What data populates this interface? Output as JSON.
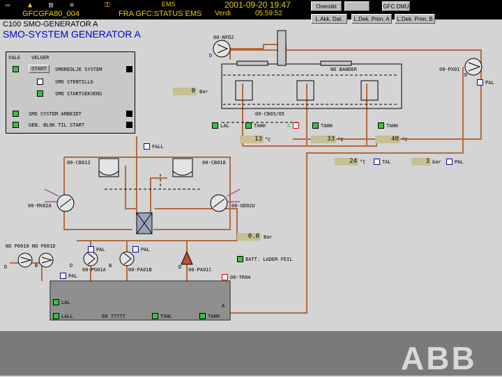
{
  "topbar": {
    "app": "EMS",
    "datetime": "2001-09-20 19:47",
    "station": "GFCGFA80_004",
    "source": "FRA GFC:STATUS EMS",
    "value_label": "Verdi",
    "time": "05:59:52",
    "btn_oversikt": "Oversikt",
    "btn_gfc_dmu": "GFC DMU",
    "btn_akk_dat": "L.Akk. Dat.",
    "btn_prim_a": "L.Dek. Prim. A",
    "btn_prim_b": "L.Dek. Prim. B"
  },
  "page": {
    "code": "C100  SMO-GENERATOR A",
    "title": "SMO-SYSTEM GENERATOR A"
  },
  "control_panel": {
    "col1": "VALG",
    "col2": "VELGER",
    "start": "START",
    "opt1": "SMOREOLJE SYSTEM",
    "opt2": "SMO STENTILLG",
    "opt3": "SMO STARTSEKVENS",
    "sys1": "SMO SYSTEM ARBEIDT",
    "sys2": "GEN. BLOK TIL START"
  },
  "labels": {
    "nfd2": "00-NFD2",
    "px01": "00-PX01",
    "no_bander": "NO BANDER",
    "cb03": "00-CB03/05",
    "cb012": "00-CB012",
    "cb018": "00-CB018",
    "mx02": "00-MX02A",
    "ud02": "00-UD02U",
    "pump1": "00-PG01A",
    "pump2": "00-PA01B",
    "pump3": "00-PA01C",
    "tr04": "00-TR04",
    "left_pumps": "NO P0010  NO P001D",
    "pal": "PAL",
    "tal": "TAL",
    "tsh": "TSH",
    "tahh": "TAHH",
    "fall": "FALL",
    "batt": "BATT. LADER FEIL",
    "lal": "LAL",
    "lall": "LALL",
    "tank_code": "00 77777",
    "tank_tshl": "TSHL",
    "tank_tahh": "TAHH",
    "a": "A",
    "d": "D",
    "b": "B"
  },
  "values": {
    "v_top": "0",
    "u_top": "Bar",
    "v_t1": "13",
    "v_t2": "33",
    "v_t3": "40",
    "u_c": "°C",
    "v_t4": "24",
    "v_p1": "3",
    "u_bar": "bar",
    "v_mid": "0.0",
    "u_mid": "Bar"
  },
  "logo": "ABB",
  "colors": {
    "pipe": "#b46a3c",
    "alarm_blue": "#0000c8",
    "ok_green": "#3cc040",
    "magenta": "#c040c0"
  }
}
